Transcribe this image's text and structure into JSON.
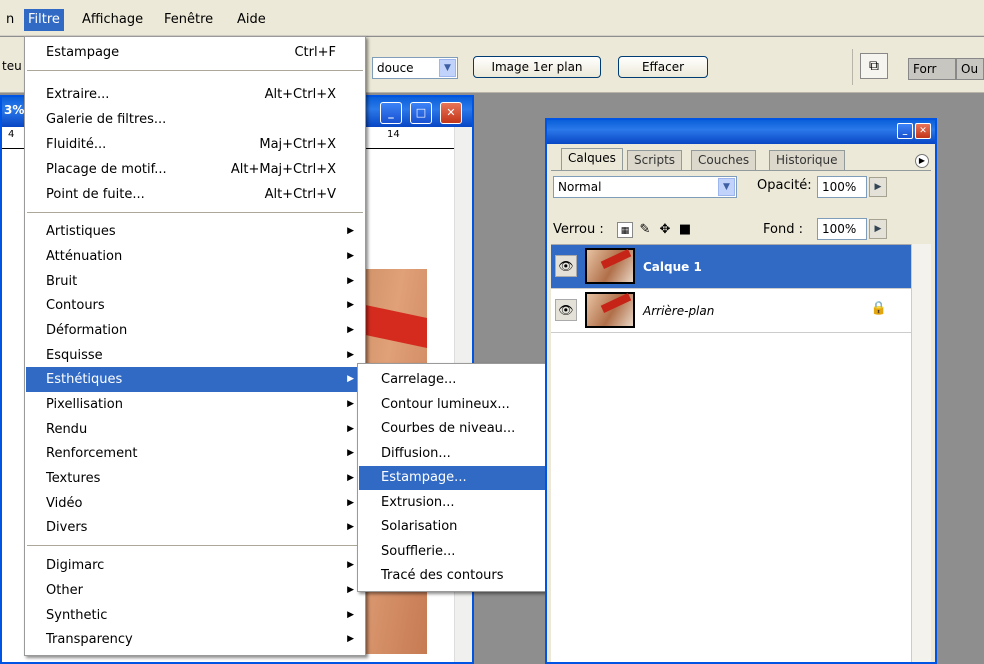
{
  "menubar": {
    "items": [
      "Filtre",
      "Affichage",
      "Fenêtre",
      "Aide"
    ],
    "cut_left": "n"
  },
  "toolbar": {
    "cut_label": "teu",
    "blend_combo": "douce",
    "btn_foreground": "Image 1er plan",
    "btn_clear": "Effacer",
    "palette_tab_1": "Forr",
    "palette_tab_2": "Ou"
  },
  "document": {
    "zoom_fragment": "3%",
    "ruler_label": "14",
    "ruler_left": "4"
  },
  "filter_menu": {
    "last_filter": {
      "label": "Estampage",
      "shortcut": "Ctrl+F"
    },
    "group1": [
      {
        "label": "Extraire...",
        "shortcut": "Alt+Ctrl+X"
      },
      {
        "label": "Galerie de filtres...",
        "shortcut": ""
      },
      {
        "label": "Fluidité...",
        "shortcut": "Maj+Ctrl+X"
      },
      {
        "label": "Placage de motif...",
        "shortcut": "Alt+Maj+Ctrl+X"
      },
      {
        "label": "Point de fuite...",
        "shortcut": "Alt+Ctrl+V"
      }
    ],
    "group2": [
      "Artistiques",
      "Atténuation",
      "Bruit",
      "Contours",
      "Déformation",
      "Esquisse",
      "Esthétiques",
      "Pixellisation",
      "Rendu",
      "Renforcement",
      "Textures",
      "Vidéo",
      "Divers"
    ],
    "group3": [
      "Digimarc",
      "Other",
      "Synthetic",
      "Transparency"
    ]
  },
  "submenu": {
    "items": [
      "Carrelage...",
      "Contour lumineux...",
      "Courbes de niveau...",
      "Diffusion...",
      "Estampage...",
      "Extrusion...",
      "Solarisation",
      "Soufflerie...",
      "Tracé des contours"
    ]
  },
  "layers_panel": {
    "tabs": [
      "Calques",
      "Scripts",
      "Couches",
      "Historique"
    ],
    "blend_mode": "Normal",
    "opacity_label": "Opacité:",
    "opacity_value": "100%",
    "lock_label": "Verrou :",
    "fill_label": "Fond :",
    "fill_value": "100%",
    "layers": [
      {
        "name": "Calque 1"
      },
      {
        "name": "Arrière-plan"
      }
    ]
  },
  "colors": {
    "highlight": "#316ac5",
    "xp_blue": "#0054e3",
    "menu_bg": "#ece9d8"
  }
}
